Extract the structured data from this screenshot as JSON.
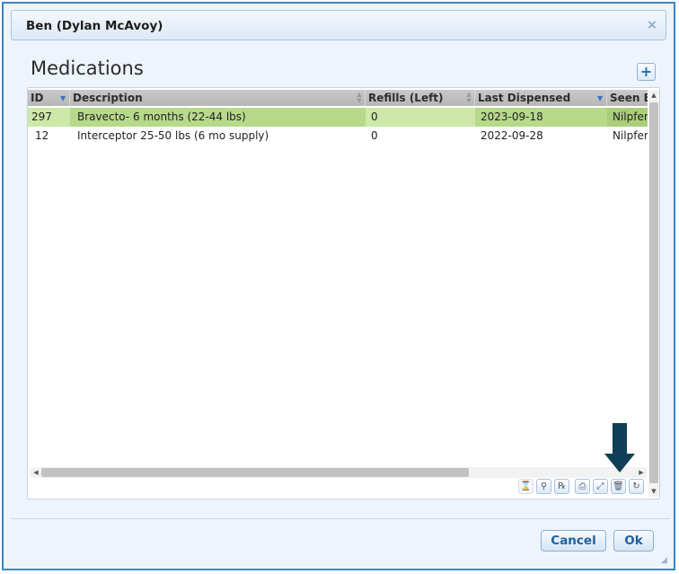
{
  "dialog": {
    "title": "Ben (Dylan McAvoy)",
    "close_label": "×"
  },
  "section": {
    "heading": "Medications",
    "add_label": "+"
  },
  "grid": {
    "columns": [
      {
        "label": "ID"
      },
      {
        "label": "Description"
      },
      {
        "label": "Refills (Left)"
      },
      {
        "label": "Last Dispensed"
      },
      {
        "label": "Seen B"
      }
    ],
    "rows": [
      {
        "id": "297",
        "description": "Bravecto- 6 months (22-44 lbs)",
        "refills": "0",
        "last_dispensed": "2023-09-18",
        "seen_by": "Nilpfer",
        "selected": true
      },
      {
        "id": "12",
        "description": "Interceptor 25-50 lbs (6 mo supply)",
        "refills": "0",
        "last_dispensed": "2022-09-28",
        "seen_by": "Nilpfer",
        "selected": false
      }
    ]
  },
  "toolbar": {
    "icons": [
      "hourglass-icon",
      "patient-icon",
      "rx-icon",
      "print-icon",
      "edit-icon",
      "trash-icon",
      "refresh-icon"
    ],
    "glyphs": [
      "⌛",
      "⚲",
      "℞",
      "⎙",
      "⤢",
      "🗑",
      "↻"
    ]
  },
  "annotation": {
    "arrow_color": "#0e3f57"
  },
  "footer": {
    "cancel_label": "Cancel",
    "ok_label": "Ok"
  },
  "colors": {
    "border_accent": "#3a86c8",
    "selected_row": "#cde8a8"
  }
}
